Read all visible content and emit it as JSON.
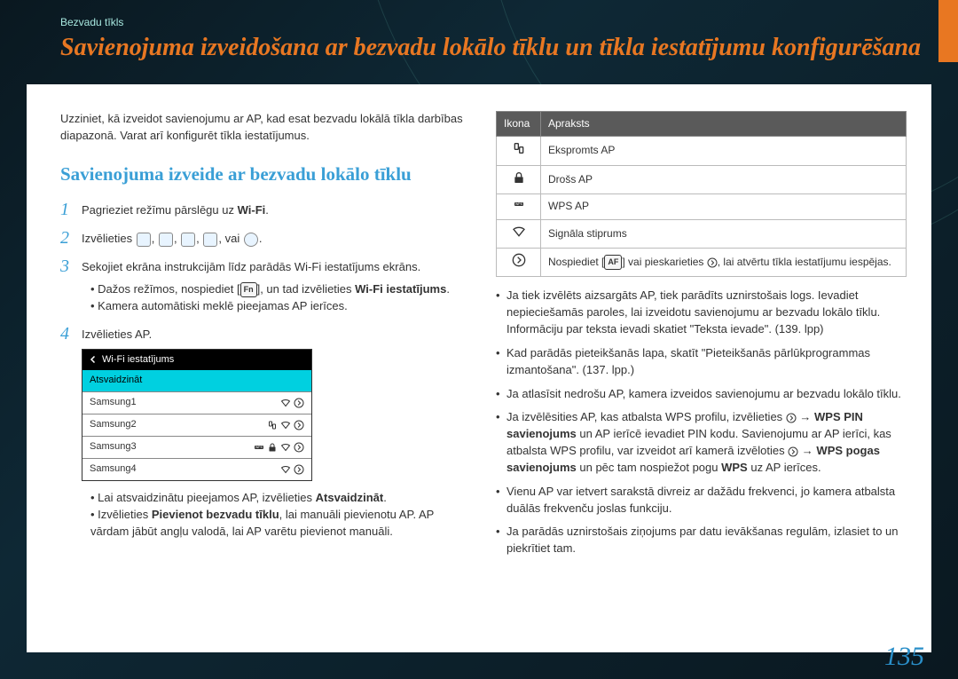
{
  "breadcrumb": "Bezvadu tīkls",
  "title": "Savienojuma izveidošana ar bezvadu lokālo tīklu un tīkla iestatījumu konfigurēšana",
  "intro": "Uzziniet, kā izveidot savienojumu ar AP, kad esat bezvadu lokālā tīkla darbības diapazonā. Varat arī konfigurēt tīkla iestatījumus.",
  "section_h": "Savienojuma izveide ar bezvadu lokālo tīklu",
  "step1_a": "Pagrieziet režīmu pārslēgu uz ",
  "wifi_label": "Wi-Fi",
  "step2_a": "Izvēlieties ",
  "step2_b": ", vai ",
  "step3": "Sekojiet ekrāna instrukcijām līdz parādās Wi-Fi iestatījums ekrāns.",
  "step3_b1a": "Dažos režīmos, nospiediet [",
  "step3_b1b": "], un tad izvēlieties ",
  "step3_b1c": "Wi-Fi iestatījums",
  "step3_b2": "Kamera automātiski meklē pieejamas AP ierīces.",
  "step4": "Izvēlieties AP.",
  "wifi_panel": {
    "header": "Wi-Fi iestatījums",
    "refresh": "Atsvaidzināt",
    "rows": [
      "Samsung1",
      "Samsung2",
      "Samsung3",
      "Samsung4"
    ]
  },
  "step4_b1a": "Lai atsvaidzinātu pieejamos AP, izvēlieties ",
  "step4_b1b": "Atsvaidzināt",
  "step4_b2a": "Izvēlieties ",
  "step4_b2b": "Pievienot bezvadu tīklu",
  "step4_b2c": ", lai manuāli pievienotu AP. AP vārdam jābūt angļu valodā, lai AP varētu pievienot manuāli.",
  "table": {
    "h1": "Ikona",
    "h2": "Apraksts",
    "rows": [
      {
        "desc": "Ekspromts AP",
        "icon": "adhoc"
      },
      {
        "desc": "Drošs AP",
        "icon": "lock"
      },
      {
        "desc": "WPS AP",
        "icon": "wps"
      },
      {
        "desc": "Signāla stiprums",
        "icon": "signal"
      }
    ],
    "row5a": "Nospiediet [",
    "row5b": "] vai pieskarieties ",
    "row5c": ", lai atvērtu tīkla iestatījumu iespējas."
  },
  "r_bullets": {
    "b1": "Ja tiek izvēlēts aizsargāts AP, tiek parādīts uznirstošais logs. Ievadiet nepieciešamās paroles, lai izveidotu savienojumu ar bezvadu lokālo tīklu. Informāciju par teksta ievadi skatiet \"Teksta ievade\". (139. lpp)",
    "b2": "Kad parādās pieteikšanās lapa, skatīt \"Pieteikšanās pārlūkprogrammas izmantošana\". (137. lpp.)",
    "b3": "Ja atlasīsit nedrošu AP, kamera izveidos savienojumu ar bezvadu lokālo tīklu.",
    "b4a": "Ja izvēlēsities AP, kas atbalsta WPS profilu, izvēlieties ",
    "b4b": " → ",
    "b4c": "WPS PIN savienojums",
    "b4d": " un AP ierīcē ievadiet PIN kodu. Savienojumu ar AP ierīci, kas atbalsta WPS profilu, var izveidot arī kamerā izvēloties ",
    "b4e": " → ",
    "b4f": "WPS pogas savienojums",
    "b4g": " un pēc tam nospiežot pogu ",
    "b4h": "WPS",
    "b4i": " uz AP ierīces.",
    "b5": "Vienu AP var ietvert sarakstā divreiz ar dažādu frekvenci, jo kamera atbalsta duālās frekvenču joslas funkciju.",
    "b6": "Ja parādās uznirstošais ziņojums par datu ievākšanas regulām, izlasiet to un piekrītiet tam."
  },
  "pagenum": "135"
}
